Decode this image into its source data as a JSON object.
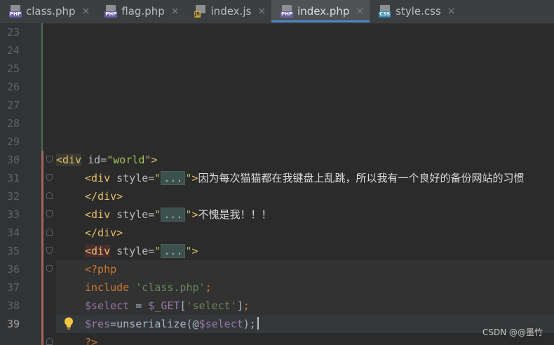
{
  "tabs": [
    {
      "label": "class.php",
      "icon": "php-file-icon",
      "type": "PHP"
    },
    {
      "label": "flag.php",
      "icon": "php-file-icon",
      "type": "PHP"
    },
    {
      "label": "index.js",
      "icon": "js-file-icon",
      "type": "JS"
    },
    {
      "label": "index.php",
      "icon": "php-file-icon",
      "type": "PHP",
      "active": true
    },
    {
      "label": "style.css",
      "icon": "css-file-icon",
      "type": "CSS"
    }
  ],
  "close_glyph": "×",
  "gutter": {
    "line_numbers": [
      "23",
      "24",
      "25",
      "26",
      "27",
      "28",
      "29",
      "30",
      "31",
      "32",
      "33",
      "34",
      "35",
      "36",
      "37",
      "38",
      "39"
    ],
    "current_line": "39"
  },
  "code": {
    "l30": {
      "open": "<div",
      "attr": " id=",
      "val": "\"world\"",
      "close": ">"
    },
    "l31": {
      "open": "<div",
      "attr": " style=",
      "q1": "\"",
      "fold": "...",
      "q2": "\"",
      "close": ">",
      "text": "因为每次猫猫都在我键盘上乱跳，所以我有一个良好的备份网站的习惯"
    },
    "l32": {
      "tag": "</div>"
    },
    "l33": {
      "open": "<div",
      "attr": " style=",
      "q1": "\"",
      "fold": "...",
      "q2": "\"",
      "close": ">",
      "text": "不愧是我！！！"
    },
    "l34": {
      "tag": "</div>"
    },
    "l35": {
      "open": "<div",
      "attr": " style=",
      "q1": "\"",
      "fold": "...",
      "q2": "\"",
      "close": ">"
    },
    "l36": {
      "php_open": "<?php"
    },
    "l37": {
      "kw": "include",
      "str": " 'class.php'",
      "end": ";"
    },
    "l38": {
      "var": "$select",
      "op": " = ",
      "get": "$_GET",
      "b1": "[",
      "key": "'select'",
      "b2": "]",
      "end": ";"
    },
    "l39": {
      "var": "$res",
      "op": "=unserialize(@",
      "var2": "$select",
      "end": ");"
    },
    "l40": {
      "php_close": "?>"
    }
  },
  "watermark": "CSDN @@墨竹",
  "colors": {
    "editor_bg": "#2b2b2b",
    "gutter_bg": "#313335",
    "tab_active_underline": "#4a88c7",
    "html_tag": "#e8bf6a",
    "string": "#6a8759",
    "variable": "#9876aa",
    "keyword": "#cc7832"
  }
}
